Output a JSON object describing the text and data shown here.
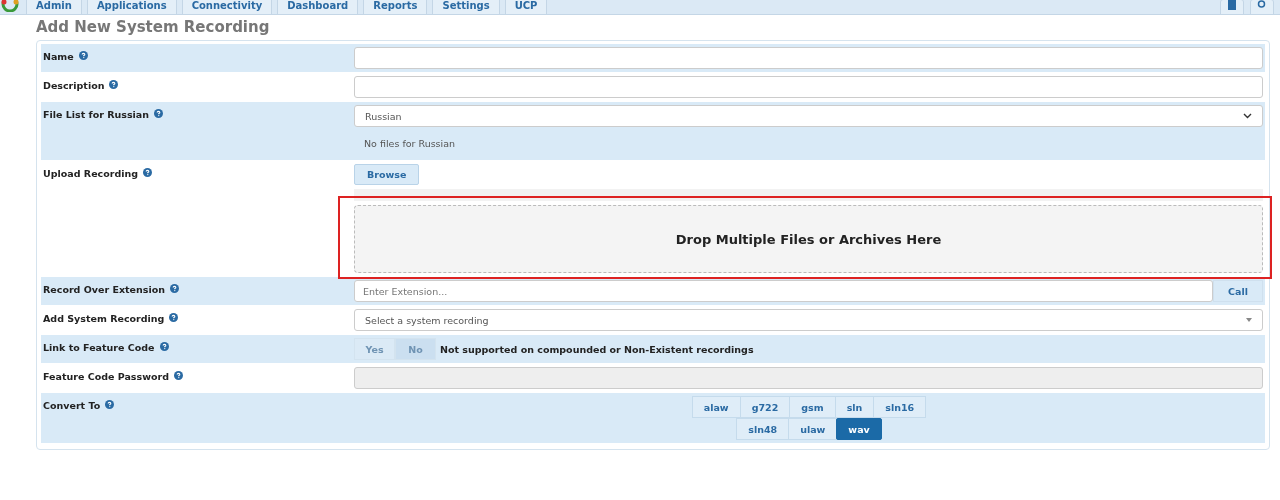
{
  "nav": {
    "tabs": [
      "Admin",
      "Applications",
      "Connectivity",
      "Dashboard",
      "Reports",
      "Settings",
      "UCP"
    ]
  },
  "page_title": "Add New System Recording",
  "form": {
    "rows": [
      {
        "kind": "text",
        "label": "Name",
        "value": ""
      },
      {
        "kind": "text",
        "label": "Description",
        "value": ""
      },
      {
        "kind": "filelist",
        "label": "File List for Russian",
        "select": "Russian",
        "note": "No files for Russian"
      },
      {
        "kind": "upload",
        "label": "Upload Recording",
        "button": "Browse",
        "dropzone": "Drop Multiple Files or Archives Here"
      },
      {
        "kind": "call",
        "label": "Record Over Extension",
        "placeholder": "Enter Extension...",
        "button": "Call"
      },
      {
        "kind": "combo",
        "label": "Add System Recording",
        "placeholder": "Select a system recording"
      },
      {
        "kind": "toggle",
        "label": "Link to Feature Code",
        "disabled": true,
        "options": [
          {
            "label": "Yes",
            "selected": false
          },
          {
            "label": "No",
            "selected": true
          }
        ],
        "note": "Not supported on compounded or Non-Existent recordings"
      },
      {
        "kind": "password",
        "label": "Feature Code Password",
        "disabled": true
      },
      {
        "kind": "formats",
        "label": "Convert To",
        "options": [
          {
            "label": "alaw",
            "selected": false
          },
          {
            "label": "g722",
            "selected": false
          },
          {
            "label": "gsm",
            "selected": false
          },
          {
            "label": "sln",
            "selected": false
          },
          {
            "label": "sln16",
            "selected": false
          },
          {
            "label": "sln48",
            "selected": false
          },
          {
            "label": "ulaw",
            "selected": false
          },
          {
            "label": "wav",
            "selected": true
          }
        ]
      }
    ]
  }
}
